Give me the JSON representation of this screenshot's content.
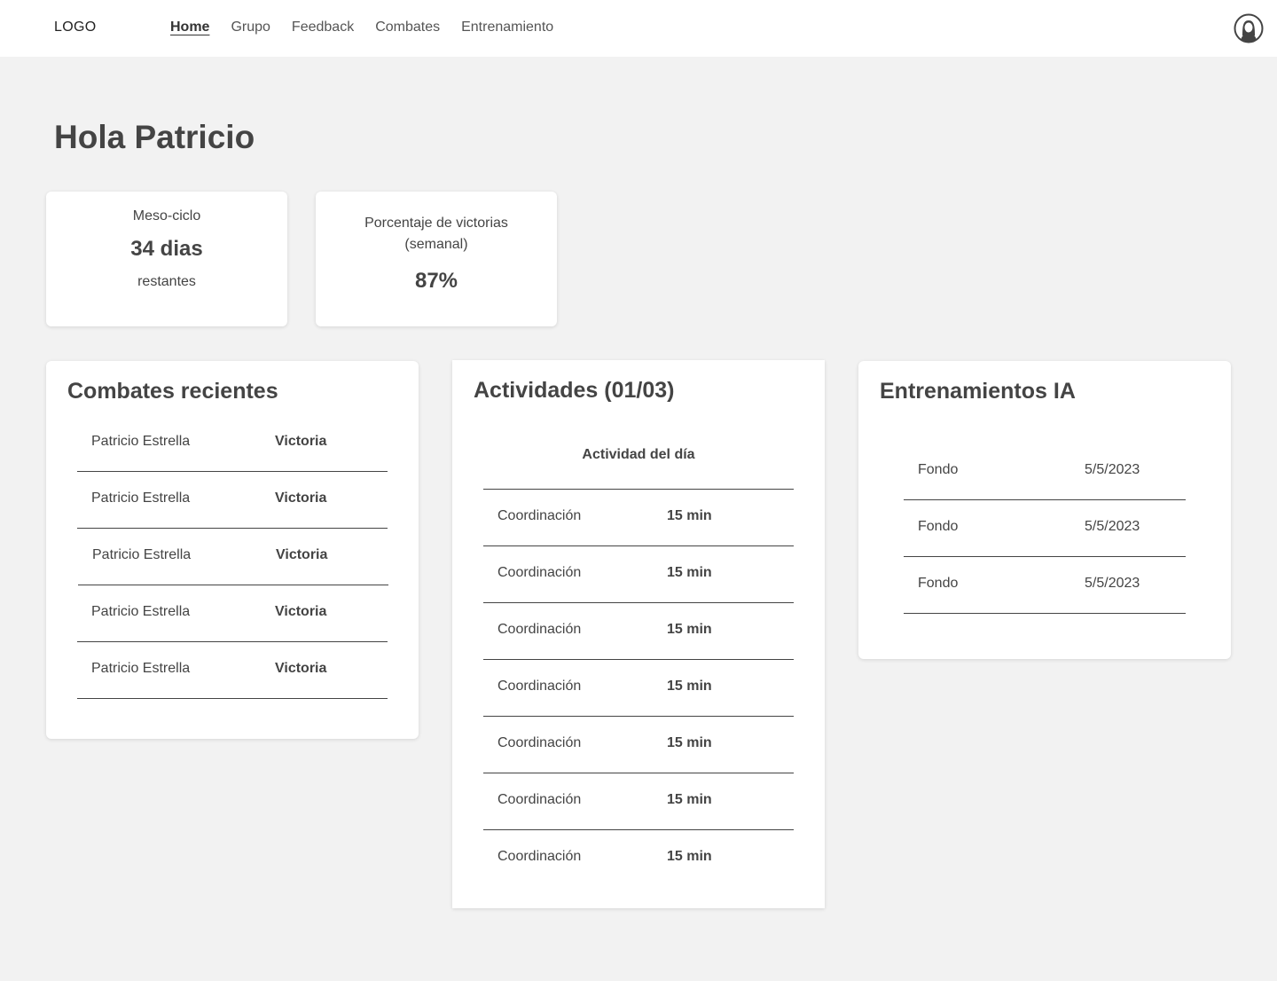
{
  "header": {
    "logo": "LOGO",
    "nav": [
      {
        "label": "Home",
        "active": true
      },
      {
        "label": "Grupo",
        "active": false
      },
      {
        "label": "Feedback",
        "active": false
      },
      {
        "label": "Combates",
        "active": false
      },
      {
        "label": "Entrenamiento",
        "active": false
      }
    ],
    "avatar_icon": "user-avatar-icon"
  },
  "greeting": "Hola Patricio",
  "stats": {
    "meso": {
      "label": "Meso-ciclo",
      "value": "34 dias",
      "sub": "restantes"
    },
    "wins": {
      "label_line1": "Porcentaje de victorias",
      "label_line2": "(semanal)",
      "value": "87%"
    }
  },
  "combates": {
    "title": "Combates recientes",
    "rows": [
      {
        "name": "Patricio Estrella",
        "result": "Victoria"
      },
      {
        "name": "Patricio Estrella",
        "result": "Victoria"
      },
      {
        "name": "Patricio Estrella",
        "result": "Victoria"
      },
      {
        "name": "Patricio Estrella",
        "result": "Victoria"
      },
      {
        "name": "Patricio Estrella",
        "result": "Victoria"
      }
    ]
  },
  "actividades": {
    "title": "Actividades (01/03)",
    "header": "Actividad del día",
    "rows": [
      {
        "activity": "Coordinación",
        "duration": "15 min"
      },
      {
        "activity": "Coordinación",
        "duration": "15 min"
      },
      {
        "activity": "Coordinación",
        "duration": "15 min"
      },
      {
        "activity": "Coordinación",
        "duration": "15 min"
      },
      {
        "activity": "Coordinación",
        "duration": "15 min"
      },
      {
        "activity": "Coordinación",
        "duration": "15 min"
      },
      {
        "activity": "Coordinación",
        "duration": "15 min"
      }
    ]
  },
  "entrenamientos": {
    "title": "Entrenamientos IA",
    "rows": [
      {
        "name": "Fondo",
        "date": "5/5/2023"
      },
      {
        "name": "Fondo",
        "date": "5/5/2023"
      },
      {
        "name": "Fondo",
        "date": "5/5/2023"
      }
    ]
  }
}
